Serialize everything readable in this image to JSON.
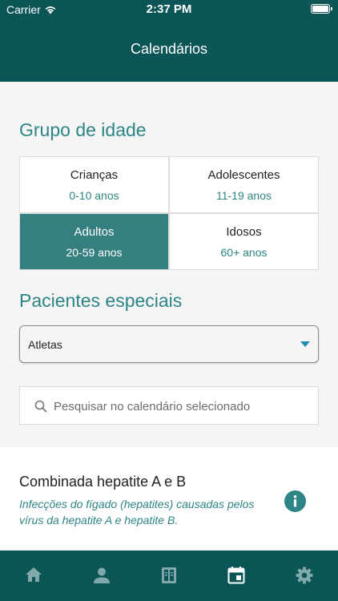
{
  "status_bar": {
    "carrier": "Carrier",
    "time": "2:37 PM"
  },
  "header": {
    "title": "Calendários"
  },
  "age_group": {
    "title": "Grupo de idade",
    "options": [
      {
        "label": "Crianças",
        "range": "0-10 anos",
        "selected": false
      },
      {
        "label": "Adolescentes",
        "range": "11-19 anos",
        "selected": false
      },
      {
        "label": "Adultos",
        "range": "20-59 anos",
        "selected": true
      },
      {
        "label": "Idosos",
        "range": "60+ anos",
        "selected": false
      }
    ]
  },
  "special_patients": {
    "title": "Pacientes especiais",
    "selected_value": "Atletas"
  },
  "search": {
    "placeholder": "Pesquisar no calendário selecionado"
  },
  "vaccine_card": {
    "title": "Combinada hepatite A e B",
    "description": "Infecções do fígado (hepatites) causadas pelos vírus da hepatite A e hepatite B."
  },
  "tab_bar": {
    "items": [
      {
        "icon": "home-icon",
        "selected": false
      },
      {
        "icon": "person-icon",
        "selected": false
      },
      {
        "icon": "book-icon",
        "selected": false
      },
      {
        "icon": "calendar-icon",
        "selected": true
      },
      {
        "icon": "gear-icon",
        "selected": false
      }
    ]
  },
  "colors": {
    "primary_dark": "#0b5557",
    "accent_teal": "#2e8585",
    "selected_cell": "#357f80",
    "dropdown_caret": "#1e88b4",
    "tab_inactive": "#7fa9aa",
    "tab_active": "#ffffff"
  }
}
